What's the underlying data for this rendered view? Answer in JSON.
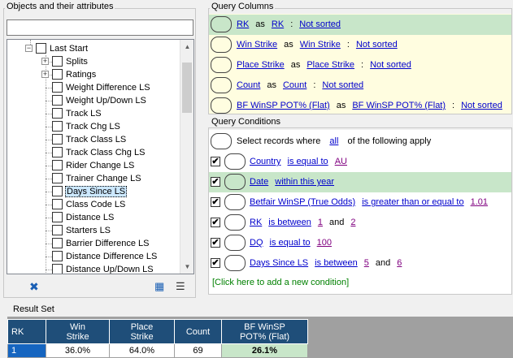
{
  "left_panel": {
    "title": "Objects and their attributes",
    "search_value": "",
    "tree": {
      "root_label": "Last Start",
      "items": [
        {
          "label": "Splits",
          "expandable": true
        },
        {
          "label": "Ratings",
          "expandable": true
        },
        {
          "label": "Weight Difference LS"
        },
        {
          "label": "Weight Up/Down LS"
        },
        {
          "label": "Track LS"
        },
        {
          "label": "Track Chg LS"
        },
        {
          "label": "Track Class LS"
        },
        {
          "label": "Track Class Chg LS"
        },
        {
          "label": "Rider Change LS"
        },
        {
          "label": "Trainer Change LS"
        },
        {
          "label": "Days Since LS",
          "selected": true
        },
        {
          "label": "Class Code LS"
        },
        {
          "label": "Distance LS"
        },
        {
          "label": "Starters LS"
        },
        {
          "label": "Barrier Difference LS"
        },
        {
          "label": "Distance Difference LS"
        },
        {
          "label": "Distance Up/Down LS"
        }
      ]
    },
    "toolbar": {
      "tool_icon": "wand-icon",
      "grid_icon": "grid-view-icon",
      "list_icon": "list-view-icon"
    }
  },
  "query_columns": {
    "title": "Query Columns",
    "as_word": "as",
    "colon": ":",
    "rows": [
      {
        "field": "RK",
        "alias": "RK",
        "sort": "Not sorted",
        "highlight": true
      },
      {
        "field": "Win Strike",
        "alias": "Win Strike",
        "sort": "Not sorted"
      },
      {
        "field": "Place Strike",
        "alias": "Place Strike",
        "sort": "Not sorted"
      },
      {
        "field": "Count",
        "alias": "Count",
        "sort": "Not sorted"
      },
      {
        "field": "BF WinSP POT% (Flat)",
        "alias": "BF WinSP POT% (Flat)",
        "sort": "Not sorted"
      }
    ]
  },
  "query_conditions": {
    "title": "Query Conditions",
    "select_prefix": "Select records where",
    "select_mode": "all",
    "select_suffix": "of the following apply",
    "and_word": "and",
    "rows": [
      {
        "checked": true,
        "field": "Country",
        "op": "is equal to",
        "value": "AU",
        "style": "plain"
      },
      {
        "checked": true,
        "field": "Date",
        "op": "within this year",
        "value": "",
        "highlight": true,
        "style": "pill"
      },
      {
        "checked": true,
        "field": "Betfair WinSP (True Odds)",
        "op": "is greater than or equal to",
        "value": "1.01",
        "style": "plain"
      },
      {
        "checked": true,
        "field": "RK",
        "op": "is between",
        "value": "1",
        "value2": "2",
        "style": "pill"
      },
      {
        "checked": true,
        "field": "DQ",
        "op": "is equal to",
        "value": "100",
        "style": "pill"
      },
      {
        "checked": true,
        "field": "Days Since LS",
        "op": "is between",
        "value": "5",
        "value2": "6",
        "style": "pill"
      }
    ],
    "add_condition": "[Click here to add a new condition]"
  },
  "result_set": {
    "title": "Result Set",
    "headers": [
      "RK",
      "Win\nStrike",
      "Place\nStrike",
      "Count",
      "BF WinSP\nPOT% (Flat)"
    ],
    "rows": [
      [
        "1",
        "36.0%",
        "64.0%",
        "69",
        "26.1%"
      ]
    ]
  },
  "colors": {
    "highlight_green": "#c8e6c9",
    "columns_bg": "#fffde0",
    "header_blue": "#1f4e79",
    "rk_cell_blue": "#1565c0",
    "link_blue": "#0000cc",
    "link_purple": "#800080",
    "add_green": "#008000"
  }
}
